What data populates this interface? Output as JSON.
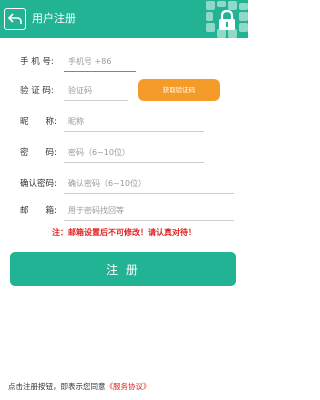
{
  "header": {
    "title": "用户注册"
  },
  "form": {
    "phone": {
      "label": "手 机 号:",
      "placeholder": "手机号 +86"
    },
    "code": {
      "label": "验 证 码:",
      "placeholder": "验证码",
      "button": "获取验证码"
    },
    "nickname": {
      "label": "昵　　称:",
      "placeholder": "昵称"
    },
    "password": {
      "label": "密　　码:",
      "placeholder": "密码（6~10位）"
    },
    "confirm": {
      "label": "确认密码:",
      "placeholder": "确认密码（6~10位）"
    },
    "email": {
      "label": "邮　　箱:",
      "placeholder": "用于密码找回等"
    }
  },
  "warning": "注：邮箱设置后不可修改！请认真对待！",
  "register_button": "注 册",
  "footer": {
    "prefix": "点击注册按钮，即表示您同意",
    "link": "《服务协议》"
  },
  "colors": {
    "primary": "#21b393",
    "accent": "#f59b2a",
    "warning": "#e02020",
    "focus": "#2aa5c8"
  }
}
